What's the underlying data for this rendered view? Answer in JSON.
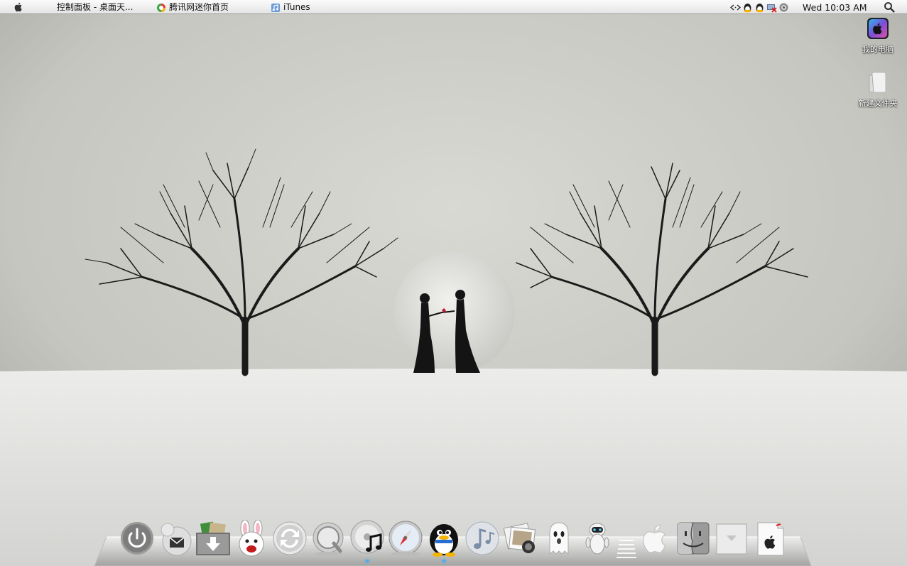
{
  "menubar": {
    "tasks": [
      {
        "label": "控制面板 - 桌面天...",
        "icon": "control-panel-icon"
      },
      {
        "label": "腾讯网迷你首页",
        "icon": "tencent-icon"
      },
      {
        "label": "iTunes",
        "icon": "itunes-icon"
      }
    ],
    "clock": "Wed 10:03 AM",
    "tray_icons": [
      "network-arrows-icon",
      "qq-icon",
      "qq-icon",
      "volume-muted-icon",
      "speaker-icon"
    ]
  },
  "desktop": {
    "icons": [
      {
        "label": "我的电脑",
        "icon": "my-computer-icon"
      },
      {
        "label": "新建文件夹",
        "icon": "folder-icon"
      }
    ]
  },
  "dock": {
    "items": [
      {
        "name": "power",
        "icon": "power-icon"
      },
      {
        "name": "mail",
        "icon": "mail-icon"
      },
      {
        "name": "downloads",
        "icon": "download-icon"
      },
      {
        "name": "rabbit",
        "icon": "rabbit-icon"
      },
      {
        "name": "sync",
        "icon": "sync-icon"
      },
      {
        "name": "quicktime",
        "icon": "quicktime-icon"
      },
      {
        "name": "itunes",
        "icon": "itunes-disc-icon"
      },
      {
        "name": "safari",
        "icon": "safari-icon"
      },
      {
        "name": "qq",
        "icon": "qq-penguin-icon"
      },
      {
        "name": "music",
        "icon": "music-icon"
      },
      {
        "name": "photos",
        "icon": "photos-icon"
      },
      {
        "name": "ghost",
        "icon": "ghost-icon"
      },
      {
        "name": "robot",
        "icon": "robot-icon"
      },
      {
        "name": "apple",
        "icon": "apple-icon"
      },
      {
        "name": "finder",
        "icon": "finder-icon"
      },
      {
        "name": "stack",
        "icon": "stack-icon"
      },
      {
        "name": "apple-doc",
        "icon": "apple-doc-icon"
      }
    ],
    "running": [
      "itunes",
      "qq"
    ]
  },
  "colors": {
    "sky": "#c9c9c3",
    "snow": "#e6e7e4",
    "tree": "#1a1a1a",
    "accent": "#5aa9e6"
  }
}
